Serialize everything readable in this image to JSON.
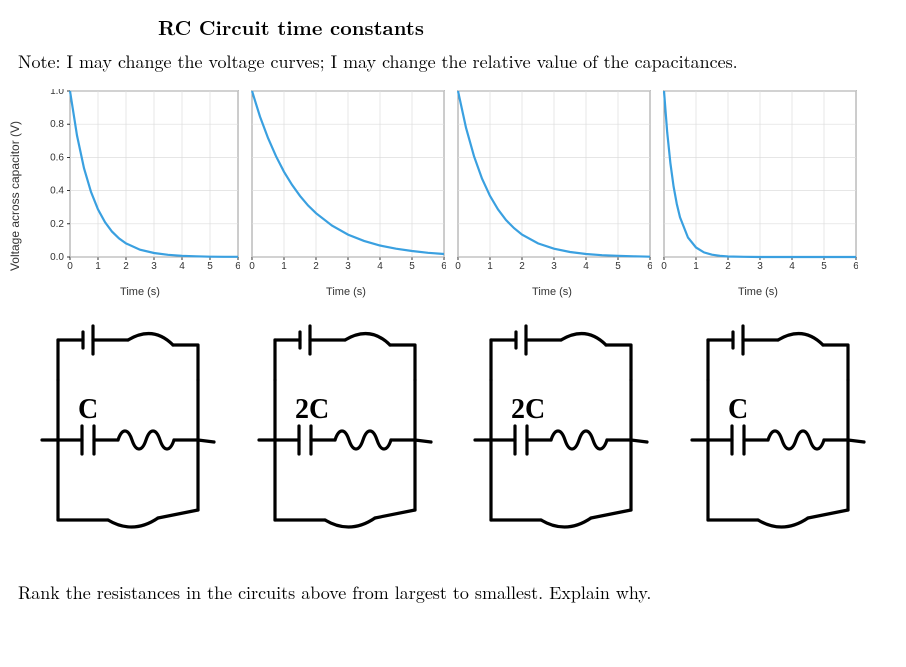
{
  "title": "RC Circuit time constants",
  "note": "Note: I may change the voltage curves; I may change the relative value of the capacitances.",
  "ylabel": "Voltage across capacitor (V)",
  "xlabel": "Time (s)",
  "question": "Rank the resistances in the circuits above from largest to smallest. Explain why.",
  "xticks": [
    "0",
    "1",
    "2",
    "3",
    "4",
    "5",
    "6"
  ],
  "yticks": [
    "0.0",
    "0.2",
    "0.4",
    "0.6",
    "0.8",
    "1.0"
  ],
  "circuits": [
    {
      "cap_label": "C"
    },
    {
      "cap_label": "2C"
    },
    {
      "cap_label": "2C"
    },
    {
      "cap_label": "C"
    }
  ],
  "chart_data": [
    {
      "type": "line",
      "title": "",
      "xlabel": "Time (s)",
      "ylabel": "Voltage across capacitor (V)",
      "xlim": [
        0,
        6
      ],
      "ylim": [
        0,
        1
      ],
      "tau": 0.8,
      "x": [
        0,
        0.25,
        0.5,
        0.75,
        1,
        1.25,
        1.5,
        1.75,
        2,
        2.5,
        3,
        3.5,
        4,
        4.5,
        5,
        5.5,
        6
      ],
      "y": [
        1.0,
        0.732,
        0.535,
        0.392,
        0.287,
        0.21,
        0.153,
        0.112,
        0.082,
        0.044,
        0.024,
        0.013,
        0.007,
        0.004,
        0.002,
        0.001,
        0.001
      ]
    },
    {
      "type": "line",
      "title": "",
      "xlabel": "Time (s)",
      "ylabel": "",
      "xlim": [
        0,
        6
      ],
      "ylim": [
        0,
        1
      ],
      "tau": 1.5,
      "x": [
        0,
        0.25,
        0.5,
        0.75,
        1,
        1.25,
        1.5,
        1.75,
        2,
        2.5,
        3,
        3.5,
        4,
        4.5,
        5,
        5.5,
        6
      ],
      "y": [
        1.0,
        0.846,
        0.717,
        0.607,
        0.513,
        0.435,
        0.368,
        0.311,
        0.264,
        0.189,
        0.135,
        0.097,
        0.069,
        0.05,
        0.036,
        0.025,
        0.018
      ]
    },
    {
      "type": "line",
      "title": "",
      "xlabel": "Time (s)",
      "ylabel": "",
      "xlim": [
        0,
        6
      ],
      "ylim": [
        0,
        1
      ],
      "tau": 1.0,
      "x": [
        0,
        0.25,
        0.5,
        0.75,
        1,
        1.25,
        1.5,
        1.75,
        2,
        2.5,
        3,
        3.5,
        4,
        4.5,
        5,
        5.5,
        6
      ],
      "y": [
        1.0,
        0.779,
        0.607,
        0.472,
        0.368,
        0.287,
        0.223,
        0.174,
        0.135,
        0.082,
        0.05,
        0.03,
        0.018,
        0.011,
        0.007,
        0.004,
        0.002
      ]
    },
    {
      "type": "line",
      "title": "",
      "xlabel": "Time (s)",
      "ylabel": "",
      "xlim": [
        0,
        6
      ],
      "ylim": [
        0,
        1
      ],
      "tau": 0.35,
      "x": [
        0,
        0.1,
        0.2,
        0.3,
        0.4,
        0.5,
        0.75,
        1,
        1.25,
        1.5,
        1.75,
        2,
        2.5,
        3,
        4,
        5,
        6
      ],
      "y": [
        1.0,
        0.751,
        0.565,
        0.424,
        0.319,
        0.239,
        0.117,
        0.057,
        0.028,
        0.014,
        0.007,
        0.003,
        0.001,
        0.0,
        0.0,
        0.0,
        0.0
      ]
    }
  ]
}
